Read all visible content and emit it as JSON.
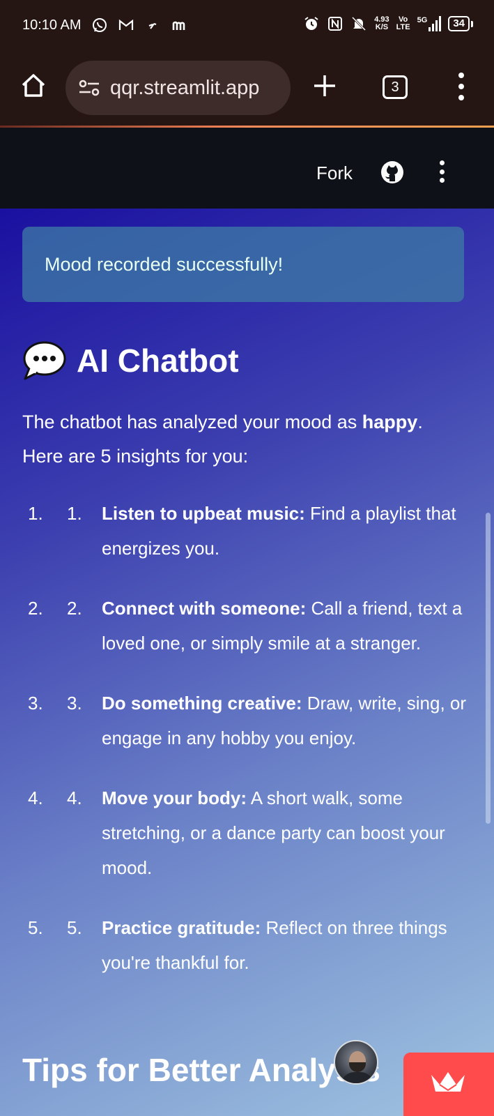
{
  "status_bar": {
    "time": "10:10 AM",
    "net_speed_value": "4.93",
    "net_speed_unit": "K/S",
    "volte_top": "Vo",
    "volte_bottom": "LTE",
    "network": "5G",
    "battery": "34"
  },
  "browser": {
    "url": "qqr.streamlit.app",
    "tab_count": "3"
  },
  "app_header": {
    "fork_label": "Fork"
  },
  "alert": {
    "message": "Mood recorded successfully!"
  },
  "chatbot": {
    "title": "AI Chatbot",
    "intro_prefix": "The chatbot has analyzed your mood as ",
    "mood": "happy",
    "intro_suffix": ".",
    "intro_line2": "Here are 5 insights for you:",
    "insights": [
      {
        "outer_num": "1.",
        "inner_num": "1.",
        "title": "Listen to upbeat music:",
        "text": " Find a playlist that energizes you."
      },
      {
        "outer_num": "2.",
        "inner_num": "2.",
        "title": "Connect with someone:",
        "text": " Call a friend, text a loved one, or simply smile at a stranger."
      },
      {
        "outer_num": "3.",
        "inner_num": "3.",
        "title": "Do something creative:",
        "text": " Draw, write, sing, or engage in any hobby you enjoy."
      },
      {
        "outer_num": "4.",
        "inner_num": "4.",
        "title": "Move your body:",
        "text": " A short walk, some stretching, or a dance party can boost your mood."
      },
      {
        "outer_num": "5.",
        "inner_num": "5.",
        "title": "Practice gratitude:",
        "text": " Reflect on three things you're thankful for."
      }
    ]
  },
  "tips": {
    "heading": "Tips for Better Analysis"
  },
  "icons": {
    "home": "home-icon",
    "tune": "tune-icon",
    "plus": "plus-icon",
    "github": "github-icon",
    "speech": "speech-bubble-icon",
    "crown": "streamlit-crown-icon"
  },
  "colors": {
    "alert_bg": "#3d78a5",
    "badge": "#ff4b4b",
    "header_bg": "#0e1117",
    "browser_bg": "#251614"
  }
}
